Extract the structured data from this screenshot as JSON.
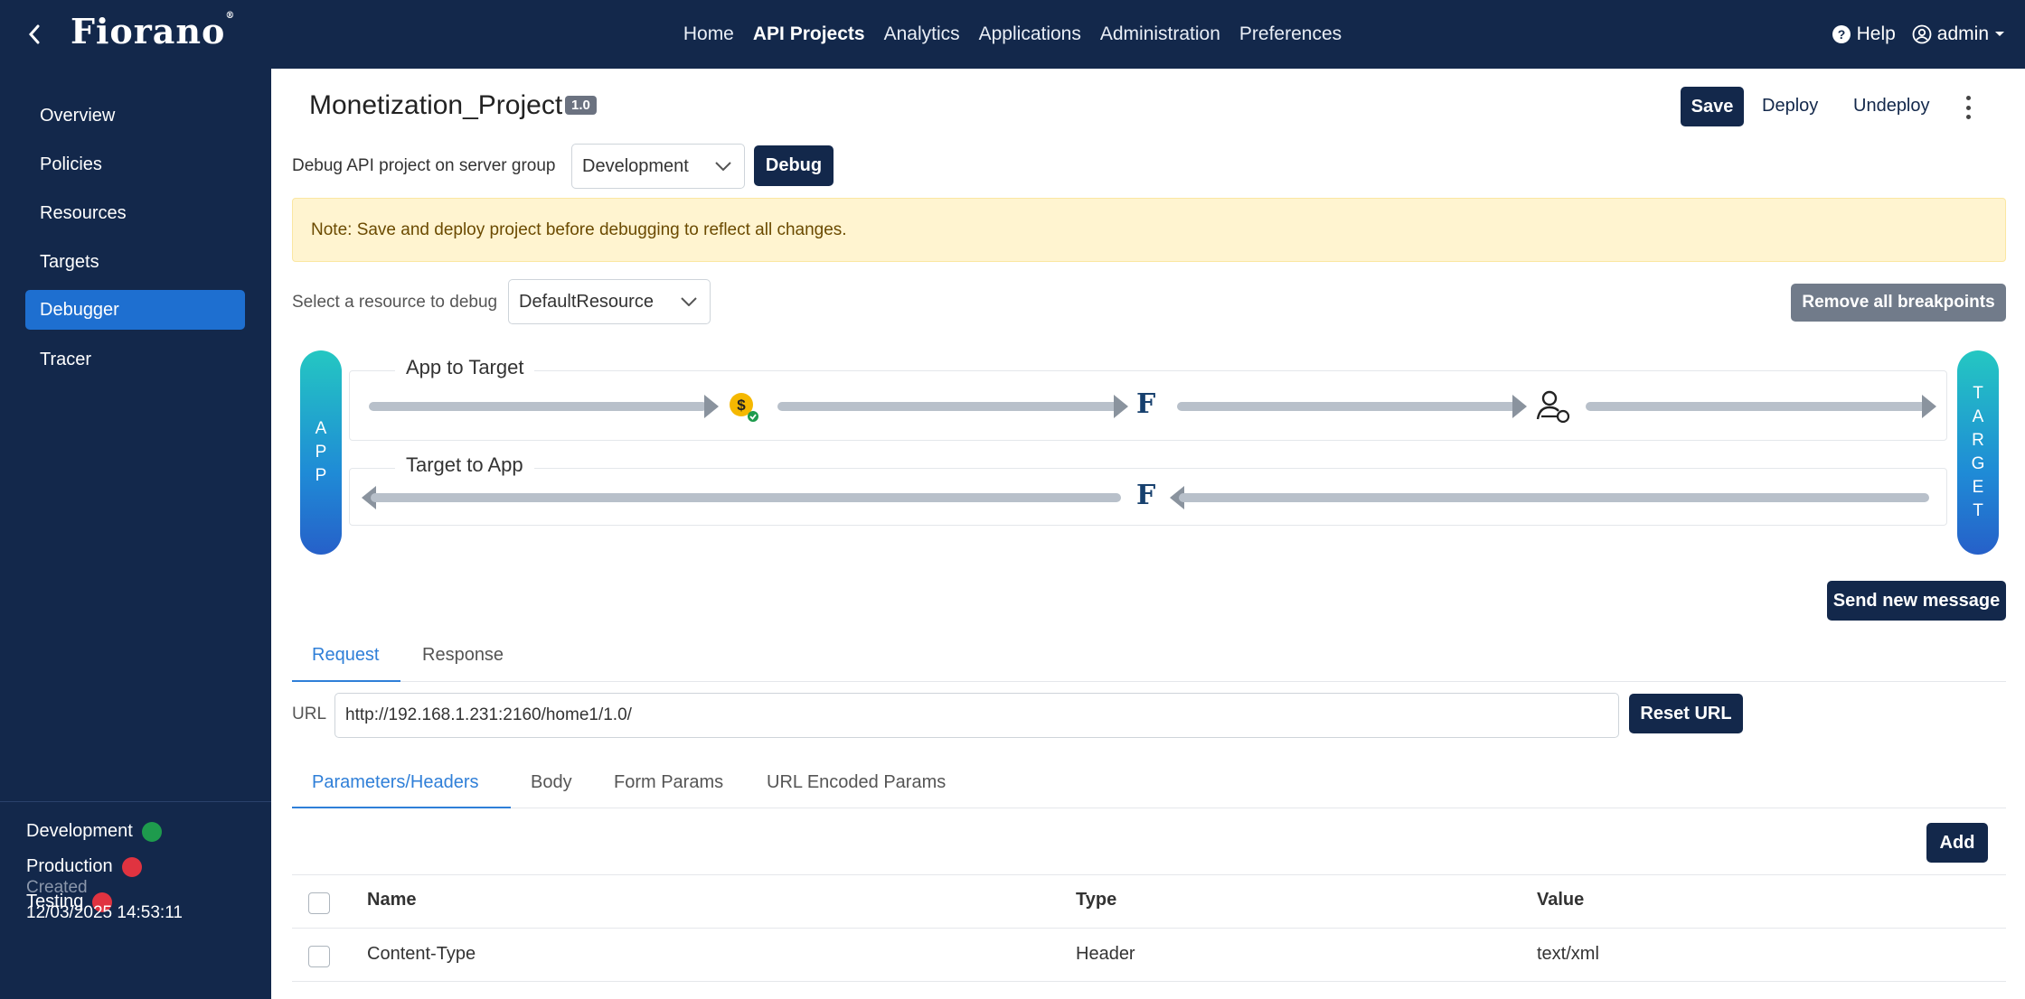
{
  "topbar": {
    "logo": "Fiorano",
    "nav": [
      "Home",
      "API Projects",
      "Analytics",
      "Applications",
      "Administration",
      "Preferences"
    ],
    "active_nav": "API Projects",
    "help": "Help",
    "user": "admin"
  },
  "sidebar": {
    "items": [
      "Overview",
      "Policies",
      "Resources",
      "Targets",
      "Debugger",
      "Tracer"
    ],
    "active": "Debugger",
    "environments": [
      {
        "name": "Development",
        "status_color": "#1e9b4d"
      },
      {
        "name": "Production",
        "status_color": "#e03340"
      },
      {
        "name": "Testing",
        "status_color": "#e03340"
      }
    ],
    "created_label": "Created",
    "created_value": "12/03/2025 14:53:11"
  },
  "header": {
    "project_name": "Monetization_Project",
    "version": "1.0",
    "save": "Save",
    "deploy": "Deploy",
    "undeploy": "Undeploy"
  },
  "debug": {
    "label": "Debug API project on server group",
    "server_group": "Development",
    "debug_button": "Debug",
    "note": "Note: Save and deploy project before debugging to reflect all changes.",
    "resource_label": "Select a resource to debug",
    "resource": "DefaultResource",
    "remove_breakpoints": "Remove all breakpoints"
  },
  "flow": {
    "app_pill": [
      "A",
      "P",
      "P"
    ],
    "target_pill": [
      "T",
      "A",
      "R",
      "G",
      "E",
      "T"
    ],
    "lane1_title": "App to Target",
    "lane2_title": "Target to App",
    "send_new_message": "Send new message"
  },
  "request": {
    "tabs": [
      "Request",
      "Response"
    ],
    "url_label": "URL",
    "url": "http://192.168.1.231:2160/home1/1.0/",
    "reset_url": "Reset URL",
    "subtabs": [
      "Parameters/Headers",
      "Body",
      "Form Params",
      "URL Encoded Params"
    ],
    "add": "Add",
    "columns": [
      "Name",
      "Type",
      "Value"
    ],
    "rows": [
      {
        "name": "Content-Type",
        "type": "Header",
        "value": "text/xml"
      }
    ]
  },
  "colors": {
    "navy": "#13284b",
    "active_blue": "#1e6fd0",
    "tab_blue": "#2f7fd8"
  }
}
